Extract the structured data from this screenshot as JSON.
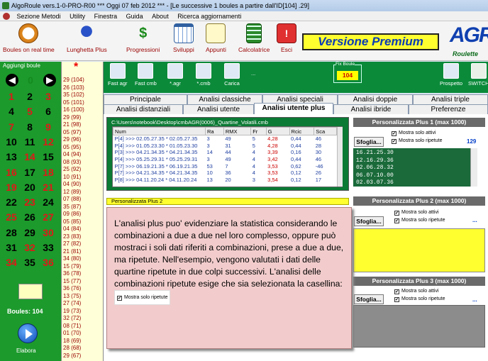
{
  "window": {
    "title": "AlgoRoule vers.1-0-PRO-R00  ***  Oggi 07 feb 2012  ***  - [Le successive 1 boules a partire dall'ID[104] .29]"
  },
  "menu": [
    "Sezione Metodi",
    "Utility",
    "Finestra",
    "Guida",
    "About",
    "Ricerca aggiornamenti"
  ],
  "toolbar": [
    {
      "label": "Boules on real time",
      "icon": "clock-icon"
    },
    {
      "label": "Lunghetta Plus",
      "icon": "lottery-icon"
    },
    {
      "label": "Progressioni",
      "icon": "dollar-icon"
    },
    {
      "label": "Sviluppi",
      "icon": "calendar-icon"
    },
    {
      "label": "Appunti",
      "icon": "notes-icon"
    },
    {
      "label": "Calcolatrice",
      "icon": "calculator-icon"
    },
    {
      "label": "Esci",
      "icon": "exit-icon"
    }
  ],
  "premium": "Versione Premium",
  "logo": {
    "big": "AGR",
    "small": "Roulette"
  },
  "left": {
    "header": "Aggiungi boule",
    "zero": "0",
    "numbers": [
      [
        "1",
        "2",
        "3"
      ],
      [
        "4",
        "5",
        "6"
      ],
      [
        "7",
        "8",
        "9"
      ],
      [
        "10",
        "11",
        "12"
      ],
      [
        "13",
        "14",
        "15"
      ],
      [
        "16",
        "17",
        "18"
      ],
      [
        "19",
        "20",
        "21"
      ],
      [
        "22",
        "23",
        "24"
      ],
      [
        "25",
        "26",
        "27"
      ],
      [
        "28",
        "29",
        "30"
      ],
      [
        "31",
        "32",
        "33"
      ],
      [
        "34",
        "35",
        "36"
      ]
    ],
    "boules_label": "Boules: 104",
    "elabora_label": "Elabora",
    "colors": {
      "red": "#e01818",
      "black": "#000000",
      "zero": "#148a1e",
      "background": "#1c9a2c"
    }
  },
  "list": {
    "star": "*",
    "items": [
      "29 (104)",
      "26 (103)",
      "35 (102)",
      "05 (101)",
      "16 (100)",
      "29 (99)",
      "21 (98)",
      "05 (97)",
      "29 (96)",
      "05 (95)",
      "04 (94)",
      "08 (93)",
      "25 (92)",
      "10 (91)",
      "04 (90)",
      "12 (89)",
      "07 (88)",
      "35 (87)",
      "09 (86)",
      "05 (85)",
      "04 (84)",
      "23 (83)",
      "27 (82)",
      "21 (81)",
      "34 (80)",
      "15 (79)",
      "36 (78)",
      "15 (77)",
      "36 (76)",
      "13 (75)",
      "27 (74)",
      "19 (73)",
      "32 (72)",
      "08 (71)",
      "01 (70)",
      "18 (69)",
      "28 (68)",
      "29 (67)"
    ]
  },
  "green_tools": [
    {
      "label": "Fast agr"
    },
    {
      "label": "Fast cmb"
    },
    {
      "label": "*.agr"
    },
    {
      "label": "*.cmb"
    },
    {
      "label": "Carica"
    }
  ],
  "fix": {
    "label": "Fix Boule",
    "value": "104"
  },
  "right_tools": [
    {
      "label": "Prospetto"
    },
    {
      "label": "SWITCH"
    }
  ],
  "dots": "...",
  "tabs_row1": [
    "Principale",
    "Analisi classiche",
    "Analisi speciali",
    "Analisi doppie",
    "Analisi triple"
  ],
  "tabs_row2": [
    "Analisi distanziali",
    "Analisi utente",
    "Analisi utente plus",
    "Analisi ibride",
    "Preferenze"
  ],
  "table": {
    "path": "C:\\Users\\notebook\\Desktop\\cmbAGR(0006)_Quartine_Volatili.cmb",
    "columns": [
      "Num",
      "Ra",
      "RMX",
      "Fr",
      "G",
      "Rcic",
      "Sca"
    ],
    "rows": [
      [
        "P[4] >>> 02.05.27.35 * 02.05.27.35",
        "3",
        "49",
        "5",
        "4,28",
        "0,44",
        "46"
      ],
      [
        "P[4] >>> 01.05.23.30 * 01.05.23.30",
        "3",
        "31",
        "5",
        "4,28",
        "0,44",
        "28"
      ],
      [
        "P[3] >>> 04.21.34.35 * 04.21.34.35",
        "14",
        "44",
        "4",
        "3,39",
        "0,16",
        "30"
      ],
      [
        "P[4] >>> 05.25.29.31 * 05.25.29.31",
        "3",
        "49",
        "4",
        "3,42",
        "0,44",
        "46"
      ],
      [
        "P[7] >>> 06.19.21.35 * 06.19.21.35",
        "53",
        "7",
        "4",
        "3,53",
        "0,62",
        "-46"
      ],
      [
        "P[7] >>> 04.21.34.35 * 04.21.34.35",
        "10",
        "36",
        "4",
        "3,53",
        "0,12",
        "26"
      ],
      [
        "P[8] >>> 04.11.20.24 * 04.11.20.24",
        "13",
        "20",
        "3",
        "3,54",
        "0,12",
        "17"
      ]
    ]
  },
  "plus1": {
    "title": "Personalizzata Plus 1 (max 1000)",
    "sfoglia": "Sfoglia...",
    "chk_attivi": "Mostra solo attivi",
    "chk_ripetute": "Mostra solo ripetute",
    "count": "129",
    "values": [
      "16.21.25.30",
      "12.16.29.36",
      "02.06.28.32",
      "06.07.10.00",
      "02.03.07.36"
    ]
  },
  "plus2": {
    "title": "Personalizzata Plus 2 (max 1000)",
    "bar_label": "Personalizzata Plus 2",
    "sfoglia": "Sfoglia...",
    "chk_attivi": "Mostra solo attivi",
    "chk_ripetute": "Mostra solo ripetute"
  },
  "plus3": {
    "title": "Personalizzata Plus 3 (max 1000)",
    "sfoglia": "Sfoglia...",
    "chk_attivi": "Mostra solo attivi",
    "chk_ripetute": "Mostra solo ripetute"
  },
  "note": {
    "text": "L'analisi plus puo' evidenziare la statistica considerando le combinazioni a due a due nel loro complesso, oppure può mostraci i soli dati riferiti a combinazioni, prese a due a due, ma ripetute. Nell'esempio, vengono valutati i dati delle quartine ripetute in due colpi successivi. L'analisi delle combinazioni ripetute esige che sia selezionata la casellina:",
    "chk": "Mostra solo ripetute"
  }
}
